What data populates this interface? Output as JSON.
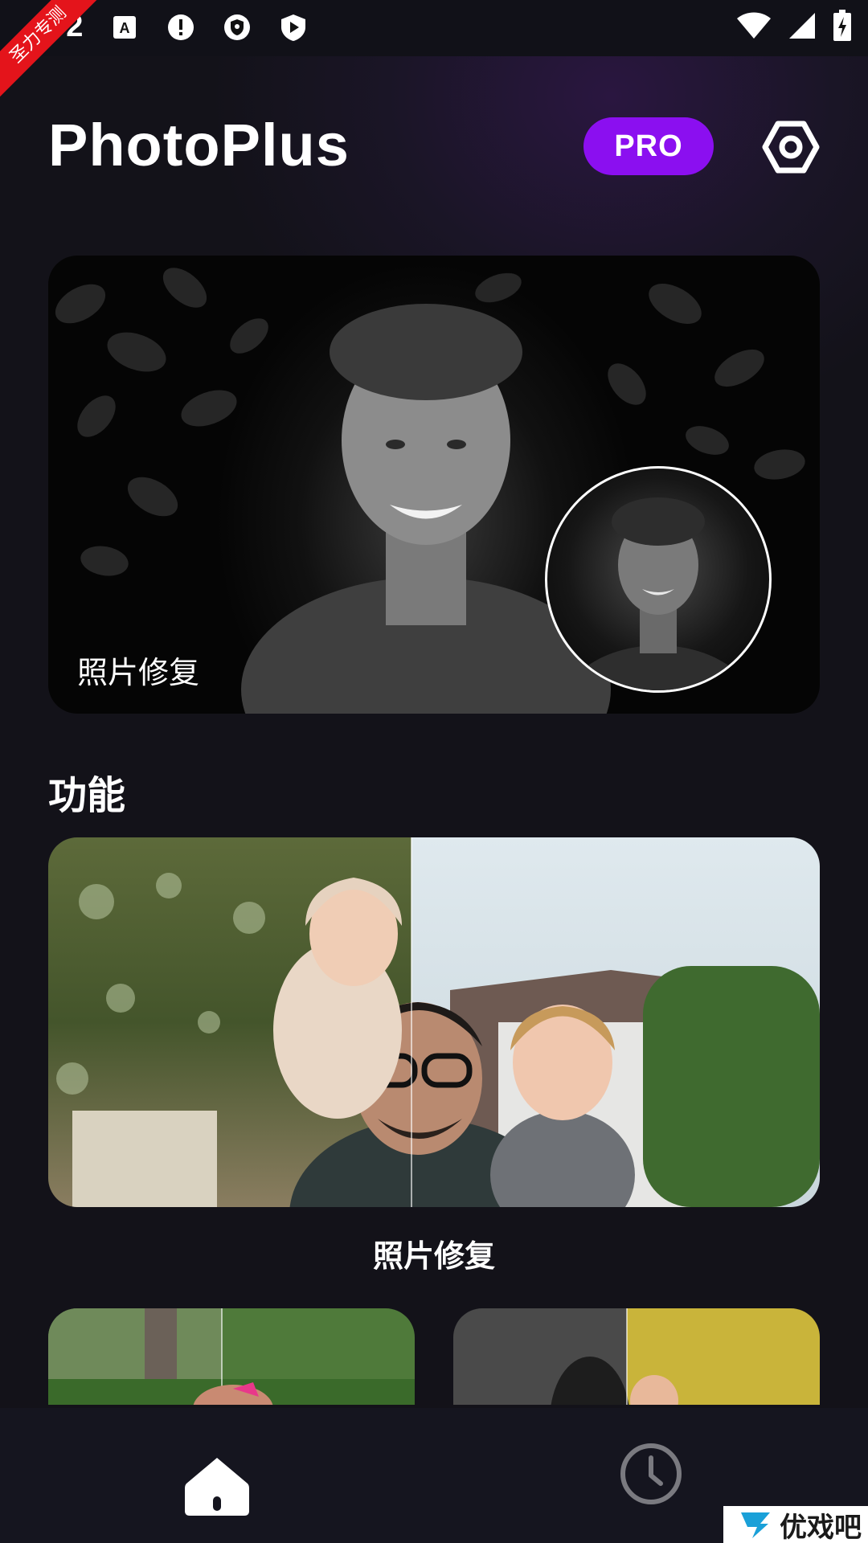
{
  "status_bar": {
    "notification_count": "+2",
    "ribbon_text": "圣力专测"
  },
  "header": {
    "app_title": "PhotoPlus",
    "pro_label": "PRO"
  },
  "hero": {
    "label": "照片修复"
  },
  "features": {
    "section_title": "功能",
    "main_card_label": "照片修复"
  },
  "watermark": {
    "text": "优戏吧"
  },
  "colors": {
    "accent": "#8b0ff0",
    "background": "#14131d",
    "nav_background": "#15151f",
    "nav_inactive": "#7a7a80"
  }
}
